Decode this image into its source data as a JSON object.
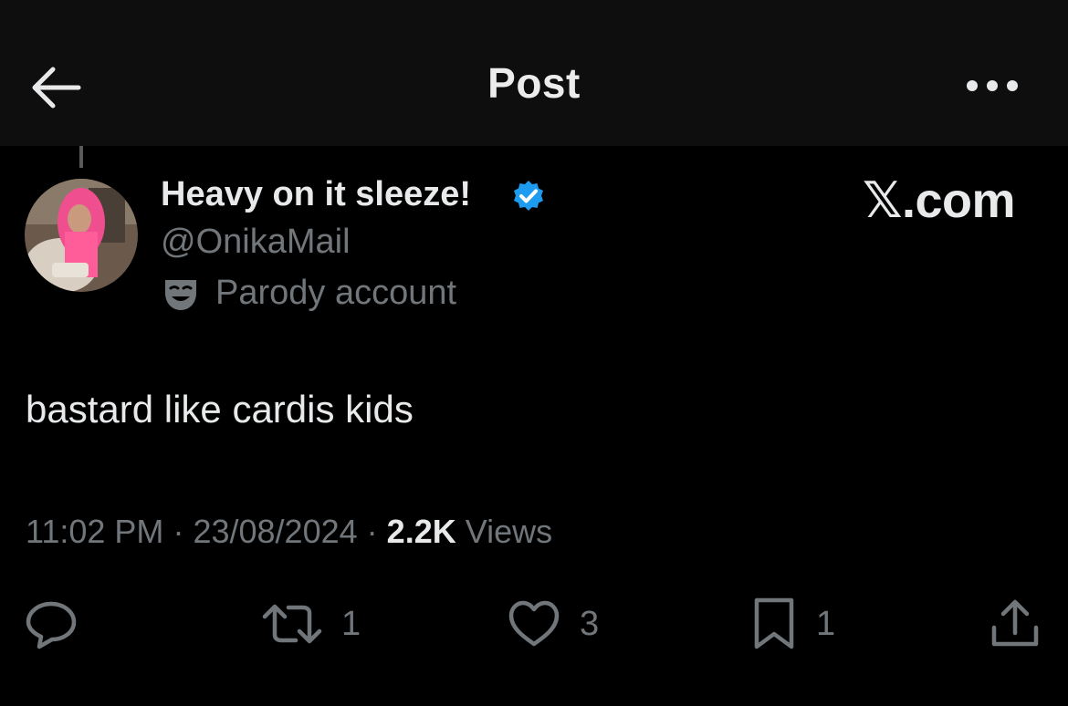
{
  "header": {
    "title": "Post",
    "back_icon": "arrow-left-icon",
    "more_icon": "more-horizontal-icon"
  },
  "post": {
    "author": {
      "display_name": "Heavy on it sleeze!",
      "handle": "@OnikaMail",
      "verified": true,
      "verified_color": "#1d9bf0",
      "label": "Parody account",
      "label_icon": "theater-mask-icon"
    },
    "watermark": "𝕏.com",
    "text": "bastard like cardis kids",
    "meta": {
      "time": "11:02 PM",
      "separator": "·",
      "date": "23/08/2024",
      "views_count": "2.2K",
      "views_label": "Views"
    },
    "actions": {
      "reply_count": "",
      "repost_count": "1",
      "like_count": "3",
      "bookmark_count": "1"
    }
  },
  "colors": {
    "background": "#000000",
    "header_background": "#0e0e0e",
    "primary_text": "#e7e9ea",
    "secondary_text": "#71767b"
  }
}
